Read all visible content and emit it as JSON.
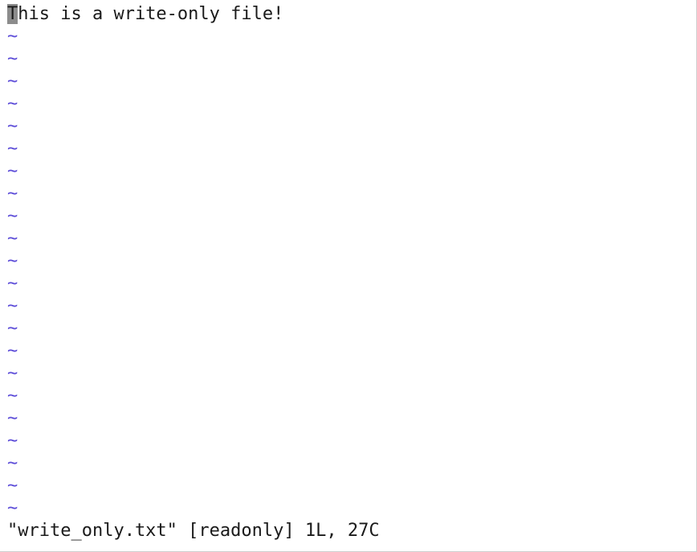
{
  "buffer": {
    "cursor_char": "T",
    "rest_of_line": "his is a write-only file!",
    "empty_line_marker": "~",
    "empty_line_count": 22,
    "empty_line_color": "#5b4bd8",
    "cursor_color": "#8c8c8c"
  },
  "status_line": {
    "message": "\"write_only.txt\" [readonly] 1L, 27C"
  }
}
